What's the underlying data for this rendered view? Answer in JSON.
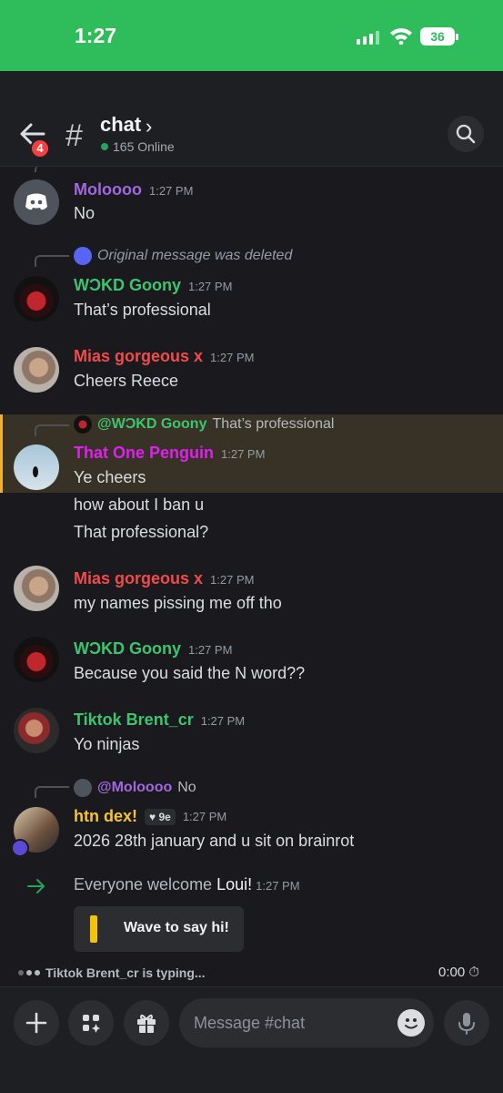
{
  "status_bar": {
    "time": "1:27",
    "battery": "36"
  },
  "header": {
    "channel": "chat",
    "chevron": "›",
    "online": "165 Online",
    "back_badge": "4"
  },
  "colors": {
    "green": "#2ebd5a",
    "purple_name": "#a167e0",
    "green_name": "#3dc46f",
    "red_name": "#f04b4b",
    "magenta_name": "#e01ff0",
    "yellow_name": "#f5c430"
  },
  "messages": [
    {
      "user": "Moloooo",
      "time": "1:27 PM",
      "lines": [
        "No"
      ]
    },
    {
      "reply_text": "Original message was deleted",
      "user": "WϽKD Goony",
      "time": "1:27 PM",
      "lines": [
        "That’s professional"
      ]
    },
    {
      "user": "Mias gorgeous x",
      "time": "1:27 PM",
      "lines": [
        "Cheers Reece"
      ]
    },
    {
      "reply_user": "@WϽKD Goony",
      "reply_text": "That’s professional",
      "user": "That One Penguin",
      "time": "1:27 PM",
      "lines": [
        "Ye cheers",
        "how about I ban u",
        "That professional?"
      ]
    },
    {
      "user": "Mias gorgeous x",
      "time": "1:27 PM",
      "lines": [
        "my names pissing me off tho"
      ]
    },
    {
      "user": "WϽKD Goony",
      "time": "1:27 PM",
      "lines": [
        "Because you said the N word??"
      ]
    },
    {
      "user": "Tiktok Brent_cr",
      "time": "1:27 PM",
      "lines": [
        "Yo ninjas"
      ]
    },
    {
      "reply_user": "@Moloooo",
      "reply_text": "No",
      "user": "htn dex!",
      "tag": "9e",
      "time": "1:27 PM",
      "lines": [
        "2026 28th january and u sit on brainrot"
      ]
    }
  ],
  "system": {
    "prefix": "Everyone welcome ",
    "name": "Loui!",
    "time": "1:27 PM",
    "wave_label": "Wave to say hi!"
  },
  "typing": {
    "text": "Tiktok Brent_cr is typing...",
    "timer": "0:00"
  },
  "composer": {
    "placeholder": "Message #chat"
  }
}
